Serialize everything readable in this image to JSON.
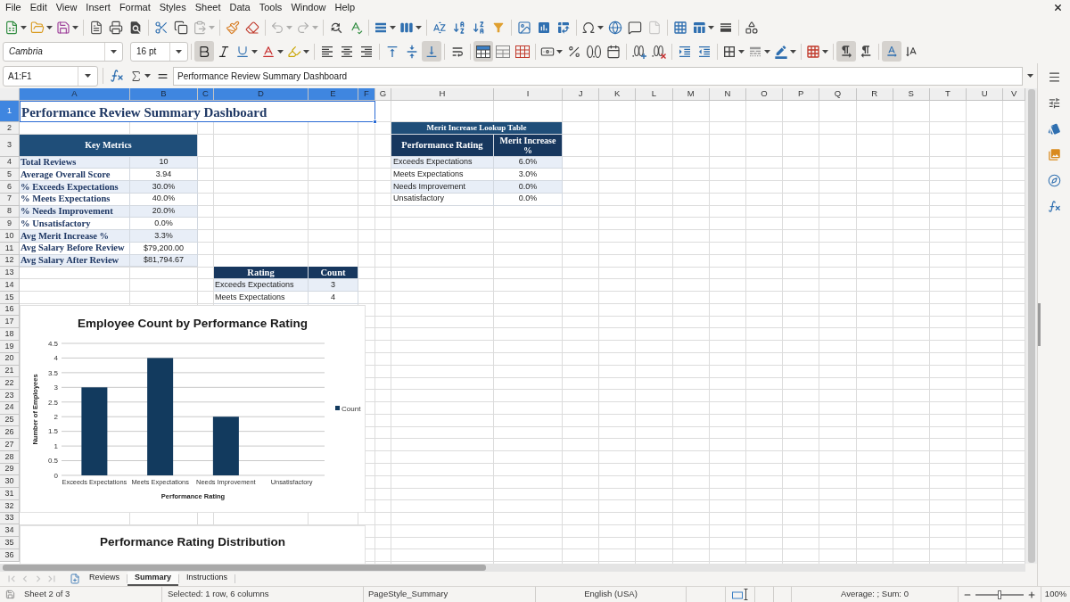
{
  "menu_bar": {
    "items": [
      "File",
      "Edit",
      "View",
      "Insert",
      "Format",
      "Styles",
      "Sheet",
      "Data",
      "Tools",
      "Window",
      "Help"
    ]
  },
  "standard_toolbar": {
    "groups": [
      [
        {
          "kind": "new",
          "disabled": false
        },
        {
          "kind": "open",
          "disabled": false
        },
        {
          "kind": "save",
          "disabled": false
        }
      ],
      [
        {
          "kind": "pdf",
          "disabled": false
        },
        {
          "kind": "print",
          "disabled": false
        },
        {
          "kind": "preview",
          "disabled": false
        }
      ],
      [
        {
          "kind": "cut",
          "disabled": false
        },
        {
          "kind": "copy",
          "disabled": false
        },
        {
          "kind": "paste",
          "disabled": true
        }
      ],
      [
        {
          "kind": "brush",
          "disabled": false
        },
        {
          "kind": "clear",
          "disabled": false
        }
      ],
      [
        {
          "kind": "undo",
          "disabled": true
        },
        {
          "kind": "redo",
          "disabled": true
        }
      ],
      [
        {
          "kind": "find",
          "disabled": false
        },
        {
          "kind": "spelling",
          "disabled": false
        }
      ],
      [
        {
          "kind": "rows",
          "disabled": false
        },
        {
          "kind": "columns",
          "disabled": false
        }
      ],
      [
        {
          "kind": "sort",
          "disabled": false
        },
        {
          "kind": "ascending",
          "disabled": false
        },
        {
          "kind": "descending",
          "disabled": false
        },
        {
          "kind": "filter",
          "disabled": false
        }
      ],
      [
        {
          "kind": "image",
          "disabled": false
        },
        {
          "kind": "chart",
          "disabled": false
        },
        {
          "kind": "pivot",
          "disabled": false
        }
      ],
      [
        {
          "kind": "symbol",
          "disabled": false
        },
        {
          "kind": "link",
          "disabled": false
        },
        {
          "kind": "comment",
          "disabled": false
        },
        {
          "kind": "header",
          "disabled": true
        }
      ],
      [
        {
          "kind": "printarea",
          "disabled": false
        },
        {
          "kind": "freeze",
          "disabled": false
        },
        {
          "kind": "split",
          "disabled": false
        }
      ],
      [
        {
          "kind": "draw",
          "disabled": false
        }
      ]
    ]
  },
  "formatting_toolbar": {
    "font_name": "Cambria",
    "font_size": "16 pt",
    "groups": [
      [
        {
          "kind": "bold",
          "pressed": true
        },
        {
          "kind": "italic",
          "pressed": false
        },
        {
          "kind": "underline",
          "pressed": false
        },
        {
          "kind": "fontcolor",
          "pressed": false
        },
        {
          "kind": "highlight",
          "pressed": false
        }
      ],
      [
        {
          "kind": "alignleft",
          "pressed": false
        },
        {
          "kind": "aligncenter",
          "pressed": false
        },
        {
          "kind": "alignright",
          "pressed": false
        }
      ],
      [
        {
          "kind": "aligntop",
          "pressed": false
        },
        {
          "kind": "alignmiddle",
          "pressed": false
        },
        {
          "kind": "alignbottom",
          "pressed": true
        }
      ],
      [
        {
          "kind": "wrap",
          "pressed": false
        }
      ],
      [
        {
          "kind": "mergecenter",
          "pressed": true
        },
        {
          "kind": "merge",
          "pressed": false
        },
        {
          "kind": "unmerge",
          "pressed": false
        }
      ],
      [
        {
          "kind": "currency",
          "pressed": false
        },
        {
          "kind": "percent",
          "pressed": false
        },
        {
          "kind": "number",
          "pressed": false
        },
        {
          "kind": "date",
          "pressed": false
        }
      ],
      [
        {
          "kind": "adddecimal",
          "pressed": false
        },
        {
          "kind": "deletedecimal",
          "pressed": false
        }
      ],
      [
        {
          "kind": "indent",
          "pressed": false
        },
        {
          "kind": "outdent",
          "pressed": false
        }
      ],
      [
        {
          "kind": "borders",
          "pressed": false
        },
        {
          "kind": "borderstyle",
          "pressed": false
        },
        {
          "kind": "bordercolor",
          "pressed": false
        }
      ],
      [
        {
          "kind": "conditional",
          "pressed": false
        }
      ],
      [
        {
          "kind": "ltr",
          "pressed": true
        },
        {
          "kind": "rtl",
          "pressed": false
        }
      ],
      [
        {
          "kind": "textlr",
          "pressed": true
        },
        {
          "kind": "texttb",
          "pressed": false
        }
      ]
    ]
  },
  "formula_bar": {
    "name_box": "A1:F1",
    "content": "Performance Review Summary Dashboard"
  },
  "sheet": {
    "columns": [
      {
        "label": "A",
        "selected": true
      },
      {
        "label": "B",
        "selected": true
      },
      {
        "label": "C",
        "selected": true
      },
      {
        "label": "D",
        "selected": true
      },
      {
        "label": "E",
        "selected": true
      },
      {
        "label": "F",
        "selected": true
      },
      {
        "label": "G",
        "selected": false
      },
      {
        "label": "H",
        "selected": false
      },
      {
        "label": "I",
        "selected": false
      },
      {
        "label": "J",
        "selected": false
      },
      {
        "label": "K",
        "selected": false
      },
      {
        "label": "L",
        "selected": false
      },
      {
        "label": "M",
        "selected": false
      },
      {
        "label": "N",
        "selected": false
      },
      {
        "label": "O",
        "selected": false
      },
      {
        "label": "P",
        "selected": false
      },
      {
        "label": "Q",
        "selected": false
      },
      {
        "label": "R",
        "selected": false
      },
      {
        "label": "S",
        "selected": false
      },
      {
        "label": "T",
        "selected": false
      },
      {
        "label": "U",
        "selected": false
      },
      {
        "label": "V",
        "selected": false
      }
    ],
    "rows": [
      {
        "label": "1",
        "selected": true
      },
      {
        "label": "2",
        "selected": false
      },
      {
        "label": "3",
        "selected": false
      },
      {
        "label": "4",
        "selected": false
      },
      {
        "label": "5",
        "selected": false
      },
      {
        "label": "6",
        "selected": false
      },
      {
        "label": "7",
        "selected": false
      },
      {
        "label": "8",
        "selected": false
      },
      {
        "label": "9",
        "selected": false
      },
      {
        "label": "10",
        "selected": false
      },
      {
        "label": "11",
        "selected": false
      },
      {
        "label": "12",
        "selected": false
      },
      {
        "label": "13",
        "selected": false
      },
      {
        "label": "14",
        "selected": false
      },
      {
        "label": "15",
        "selected": false
      },
      {
        "label": "16",
        "selected": false
      },
      {
        "label": "17",
        "selected": false
      },
      {
        "label": "18",
        "selected": false
      },
      {
        "label": "19",
        "selected": false
      },
      {
        "label": "20",
        "selected": false
      },
      {
        "label": "21",
        "selected": false
      },
      {
        "label": "22",
        "selected": false
      },
      {
        "label": "23",
        "selected": false
      },
      {
        "label": "24",
        "selected": false
      },
      {
        "label": "25",
        "selected": false
      },
      {
        "label": "26",
        "selected": false
      },
      {
        "label": "27",
        "selected": false
      },
      {
        "label": "28",
        "selected": false
      },
      {
        "label": "29",
        "selected": false
      },
      {
        "label": "30",
        "selected": false
      },
      {
        "label": "31",
        "selected": false
      },
      {
        "label": "32",
        "selected": false
      },
      {
        "label": "33",
        "selected": false
      },
      {
        "label": "34",
        "selected": false
      },
      {
        "label": "35",
        "selected": false
      },
      {
        "label": "36",
        "selected": false
      }
    ],
    "title": {
      "text": "Performance Review Summary Dashboard",
      "selected": true
    },
    "key_metrics": {
      "header": "Key Metrics",
      "rows": [
        {
          "label": "Total Reviews",
          "value": "10"
        },
        {
          "label": "Average Overall Score",
          "value": "3.94"
        },
        {
          "label": "% Exceeds Expectations",
          "value": "30.0%"
        },
        {
          "label": "% Meets Expectations",
          "value": "40.0%"
        },
        {
          "label": "% Needs Improvement",
          "value": "20.0%"
        },
        {
          "label": "% Unsatisfactory",
          "value": "0.0%"
        },
        {
          "label": "Avg Merit Increase %",
          "value": "3.3%"
        },
        {
          "label": "Avg Salary Before Review",
          "value": "$79,200.00"
        },
        {
          "label": "Avg Salary After Review",
          "value": "$81,794.67"
        }
      ]
    },
    "merit_table": {
      "title": "Merit Increase Lookup Table",
      "columns": [
        "Performance Rating",
        "Merit Increase %"
      ],
      "rows": [
        {
          "rating": "Exceeds Expectations",
          "increase": "6.0%"
        },
        {
          "rating": "Meets Expectations",
          "increase": "3.0%"
        },
        {
          "rating": "Needs Improvement",
          "increase": "0.0%"
        },
        {
          "rating": "Unsatisfactory",
          "increase": "0.0%"
        }
      ]
    },
    "rating_table": {
      "columns": [
        "Rating",
        "Count"
      ],
      "rows": [
        {
          "rating": "Exceeds Expectations",
          "count": "3"
        },
        {
          "rating": "Meets Expectations",
          "count": "4"
        }
      ]
    },
    "charts": [
      {
        "chart_data": {
          "type": "bar",
          "title": "Employee Count by Performance Rating",
          "xlabel": "Performance Rating",
          "ylabel": "Number of Employees",
          "categories": [
            "Exceeds Expectations",
            "Meets Expectations",
            "Needs Improvement",
            "Unsatisfactory"
          ],
          "series": [
            {
              "name": "Count",
              "color": "#123a5e",
              "values": [
                3,
                4,
                2,
                0
              ]
            }
          ],
          "ylim": [
            0,
            4.5
          ],
          "yticks": [
            0,
            0.5,
            1,
            1.5,
            2,
            2.5,
            3,
            3.5,
            4,
            4.5
          ],
          "grid": true
        }
      },
      {
        "title": "Performance Rating Distribution"
      }
    ]
  },
  "sheet_tabs": {
    "navigation_disabled": true,
    "tabs": [
      {
        "label": "Reviews",
        "selected": false
      },
      {
        "label": "Summary",
        "selected": true
      },
      {
        "label": "Instructions",
        "selected": false
      }
    ]
  },
  "status_bar": {
    "sheet": "Sheet 2 of 3",
    "selection": "Selected: 1 row, 6 columns",
    "page_style": "PageStyle_Summary",
    "language": "English (USA)",
    "summary": "Average: ; Sum: 0",
    "zoom": {
      "level": 0.5,
      "reading": "100%"
    }
  }
}
